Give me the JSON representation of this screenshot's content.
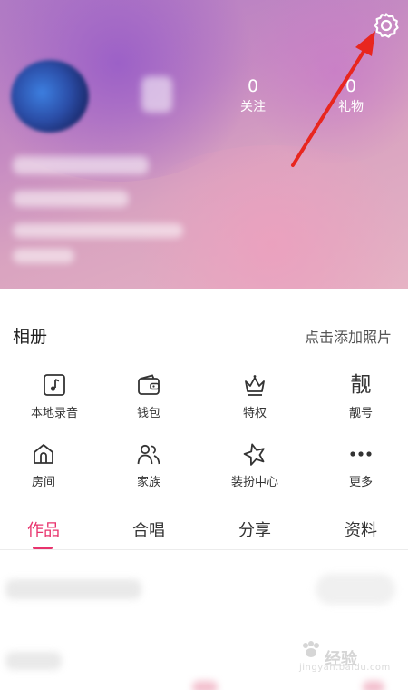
{
  "profile": {
    "stats": [
      {
        "count": "0",
        "label": "关注"
      },
      {
        "count": "0",
        "label": "礼物"
      }
    ]
  },
  "album": {
    "title": "相册",
    "add_label": "点击添加照片"
  },
  "features": [
    {
      "label": "本地录音",
      "icon": "music-note-icon"
    },
    {
      "label": "钱包",
      "icon": "wallet-icon"
    },
    {
      "label": "特权",
      "icon": "crown-icon"
    },
    {
      "label": "靓号",
      "icon": "liang-char-icon",
      "glyph": "靓"
    },
    {
      "label": "房间",
      "icon": "house-icon"
    },
    {
      "label": "家族",
      "icon": "family-icon"
    },
    {
      "label": "装扮中心",
      "icon": "star-icon"
    },
    {
      "label": "更多",
      "icon": "more-dots-icon"
    }
  ],
  "tabs": [
    {
      "label": "作品",
      "active": true
    },
    {
      "label": "合唱",
      "active": false
    },
    {
      "label": "分享",
      "active": false
    },
    {
      "label": "资料",
      "active": false
    }
  ],
  "watermark": {
    "brand": "经验",
    "domain": "jingyan.baidu.com"
  },
  "colors": {
    "accent": "#e8336d",
    "annotation_arrow": "#e8261f",
    "header_gradient": [
      "#b07bc4",
      "#e6b3c4"
    ]
  }
}
